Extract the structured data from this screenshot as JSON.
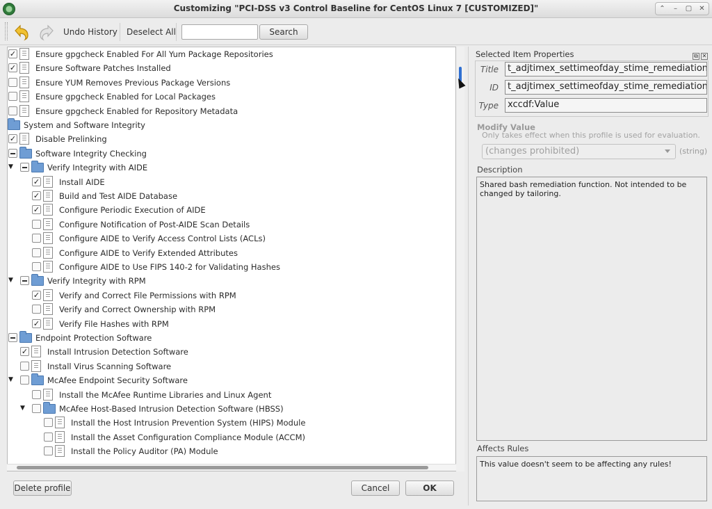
{
  "window": {
    "title": "Customizing \"PCI-DSS v3 Control Baseline for CentOS Linux 7 [CUSTOMIZED]\"",
    "controls": [
      "⌃",
      "–",
      "▢",
      "✕"
    ]
  },
  "toolbar": {
    "undo_history_label": "Undo History",
    "deselect_all_label": "Deselect All",
    "search_value": "",
    "search_button_label": "Search"
  },
  "tree": {
    "rows": [
      {
        "level": 3,
        "arrow": "",
        "check": "checked",
        "icon": "doc",
        "label": "Ensure gpgcheck Enabled For All Yum Package Repositories"
      },
      {
        "level": 3,
        "arrow": "",
        "check": "checked",
        "icon": "doc",
        "label": "Ensure Software Patches Installed"
      },
      {
        "level": 3,
        "arrow": "",
        "check": "none",
        "icon": "doc",
        "label": "Ensure YUM Removes Previous Package Versions"
      },
      {
        "level": 3,
        "arrow": "",
        "check": "none",
        "icon": "doc",
        "label": "Ensure gpgcheck Enabled for Local Packages"
      },
      {
        "level": 3,
        "arrow": "",
        "check": "none",
        "icon": "doc",
        "label": "Ensure gpgcheck Enabled for Repository Metadata"
      },
      {
        "level": 2,
        "arrow": "▼",
        "check": "partial",
        "icon": "folder",
        "label": "System and Software Integrity"
      },
      {
        "level": 3,
        "arrow": "",
        "check": "checked",
        "icon": "doc",
        "label": "Disable Prelinking"
      },
      {
        "level": 3,
        "arrow": "▼",
        "check": "partial",
        "icon": "folder",
        "label": "Software Integrity Checking"
      },
      {
        "level": 4,
        "arrow": "▼",
        "check": "partial",
        "icon": "folder",
        "label": "Verify Integrity with AIDE"
      },
      {
        "level": 5,
        "arrow": "",
        "check": "checked",
        "icon": "doc",
        "label": "Install AIDE"
      },
      {
        "level": 5,
        "arrow": "",
        "check": "checked",
        "icon": "doc",
        "label": "Build and Test AIDE Database"
      },
      {
        "level": 5,
        "arrow": "",
        "check": "checked",
        "icon": "doc",
        "label": "Configure Periodic Execution of AIDE"
      },
      {
        "level": 5,
        "arrow": "",
        "check": "none",
        "icon": "doc",
        "label": "Configure Notification of Post-AIDE Scan Details"
      },
      {
        "level": 5,
        "arrow": "",
        "check": "none",
        "icon": "doc",
        "label": "Configure AIDE to Verify Access Control Lists (ACLs)"
      },
      {
        "level": 5,
        "arrow": "",
        "check": "none",
        "icon": "doc",
        "label": "Configure AIDE to Verify Extended Attributes"
      },
      {
        "level": 5,
        "arrow": "",
        "check": "none",
        "icon": "doc",
        "label": "Configure AIDE to Use FIPS 140-2 for Validating Hashes"
      },
      {
        "level": 4,
        "arrow": "▼",
        "check": "partial",
        "icon": "folder",
        "label": "Verify Integrity with RPM"
      },
      {
        "level": 5,
        "arrow": "",
        "check": "checked",
        "icon": "doc",
        "label": "Verify and Correct File Permissions with RPM"
      },
      {
        "level": 5,
        "arrow": "",
        "check": "none",
        "icon": "doc",
        "label": "Verify and Correct Ownership with RPM"
      },
      {
        "level": 5,
        "arrow": "",
        "check": "checked",
        "icon": "doc",
        "label": "Verify File Hashes with RPM"
      },
      {
        "level": 3,
        "arrow": "▼",
        "check": "partial",
        "icon": "folder",
        "label": "Endpoint Protection Software"
      },
      {
        "level": 4,
        "arrow": "",
        "check": "checked",
        "icon": "doc",
        "label": "Install Intrusion Detection Software"
      },
      {
        "level": 4,
        "arrow": "",
        "check": "none",
        "icon": "doc",
        "label": "Install Virus Scanning Software"
      },
      {
        "level": 4,
        "arrow": "▼",
        "check": "none",
        "icon": "folder",
        "label": "McAfee Endpoint Security Software"
      },
      {
        "level": 5,
        "arrow": "",
        "check": "none",
        "icon": "doc",
        "label": "Install the McAfee Runtime Libraries and Linux Agent"
      },
      {
        "level": 5,
        "arrow": "▼",
        "check": "none",
        "icon": "folder",
        "label": "McAfee Host-Based Intrusion Detection Software (HBSS)"
      },
      {
        "level": 6,
        "arrow": "",
        "check": "none",
        "icon": "doc",
        "label": "Install the Host Intrusion Prevention System (HIPS) Module"
      },
      {
        "level": 6,
        "arrow": "",
        "check": "none",
        "icon": "doc",
        "label": "Install the Asset Configuration Compliance Module (ACCM)"
      },
      {
        "level": 6,
        "arrow": "",
        "check": "none",
        "icon": "doc",
        "label": "Install the Policy Auditor (PA) Module"
      }
    ]
  },
  "buttons": {
    "delete_profile": "Delete profile",
    "cancel": "Cancel",
    "ok": "OK"
  },
  "properties": {
    "header": "Selected Item Properties",
    "title_label": "Title",
    "title_value": "t_adjtimex_settimeofday_stime_remediation",
    "id_label": "ID",
    "id_value": "t_adjtimex_settimeofday_stime_remediation",
    "type_label": "Type",
    "type_value": "xccdf:Value",
    "modify_value_label": "Modify Value",
    "modify_hint": "Only takes effect when this profile is used for evaluation.",
    "value_select": "(changes prohibited)",
    "value_type": "(string)",
    "description_label": "Description",
    "description_text": "Shared bash remediation function. Not intended to be changed by tailoring.",
    "affects_rules_label": "Affects Rules",
    "affects_rules_text": "This value doesn't seem to be affecting any rules!"
  }
}
